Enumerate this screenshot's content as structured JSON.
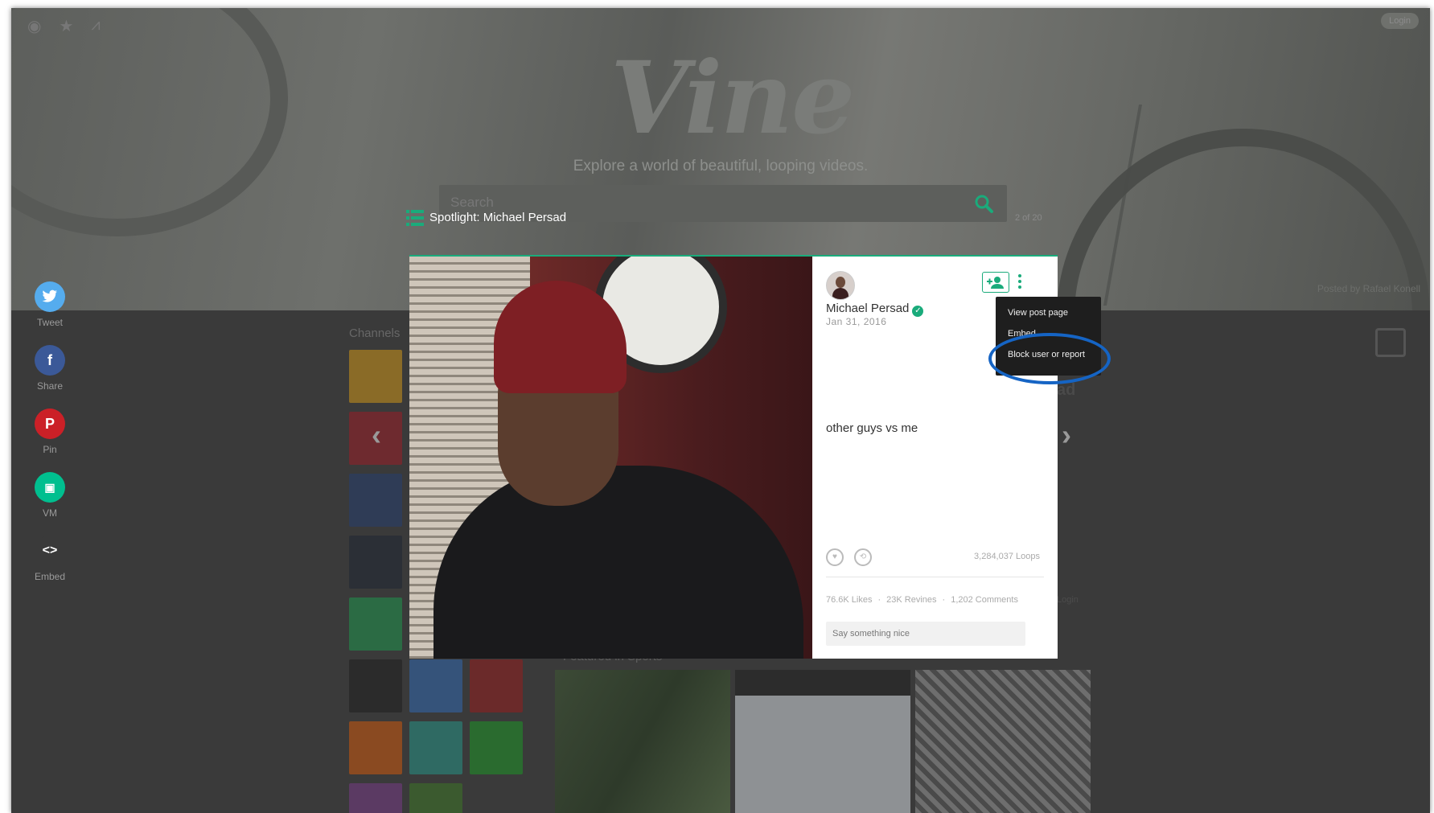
{
  "hero": {
    "logo": "Vine",
    "tagline": "Explore a world of beautiful, looping videos.",
    "search_placeholder": "Search",
    "login_label": "Login",
    "posted_by": "Posted by Rafael Konell"
  },
  "top_icons": [
    "eye-icon",
    "star-icon",
    "chart-icon"
  ],
  "channels": {
    "label": "Channels",
    "tile_colors": [
      "#8a6b27",
      "#6e2a2f",
      "#2f3c56",
      "#2b2f36",
      "#2b6b44",
      "#2b2b2b",
      "#35537a",
      "#6b2a2a",
      "#8a4a21",
      "#2f6a63",
      "#2a6b2f",
      "#5b3a63",
      "#3b5a2f"
    ]
  },
  "featured": {
    "label": "Featured in Sports"
  },
  "share": {
    "items": [
      {
        "label": "Tweet",
        "icon": "twitter-icon",
        "color": "#55acee"
      },
      {
        "label": "Share",
        "icon": "facebook-icon",
        "color": "#3b5998"
      },
      {
        "label": "Pin",
        "icon": "pinterest-icon",
        "color": "#cb2027"
      },
      {
        "label": "VM",
        "icon": "vm-icon",
        "color": "#00bf8f"
      },
      {
        "label": "Embed",
        "icon": "embed-icon",
        "color": "#3a3a3a"
      }
    ]
  },
  "spotlight": {
    "title": "Spotlight: Michael Persad",
    "count": "2 of 20"
  },
  "post": {
    "username": "Michael Persad",
    "date": "Jan 31, 2016",
    "caption": "other guys vs me",
    "loops": "3,284,037 Loops",
    "likes": "76.6K Likes",
    "revines": "23K Revines",
    "comments": "1,202 Comments",
    "comment_placeholder": "Say something nice"
  },
  "menu": {
    "items": [
      "View post page",
      "Embed",
      "Block user or report"
    ]
  },
  "colors": {
    "accent": "#1aab7b",
    "highlight_ring": "#1564c4"
  }
}
